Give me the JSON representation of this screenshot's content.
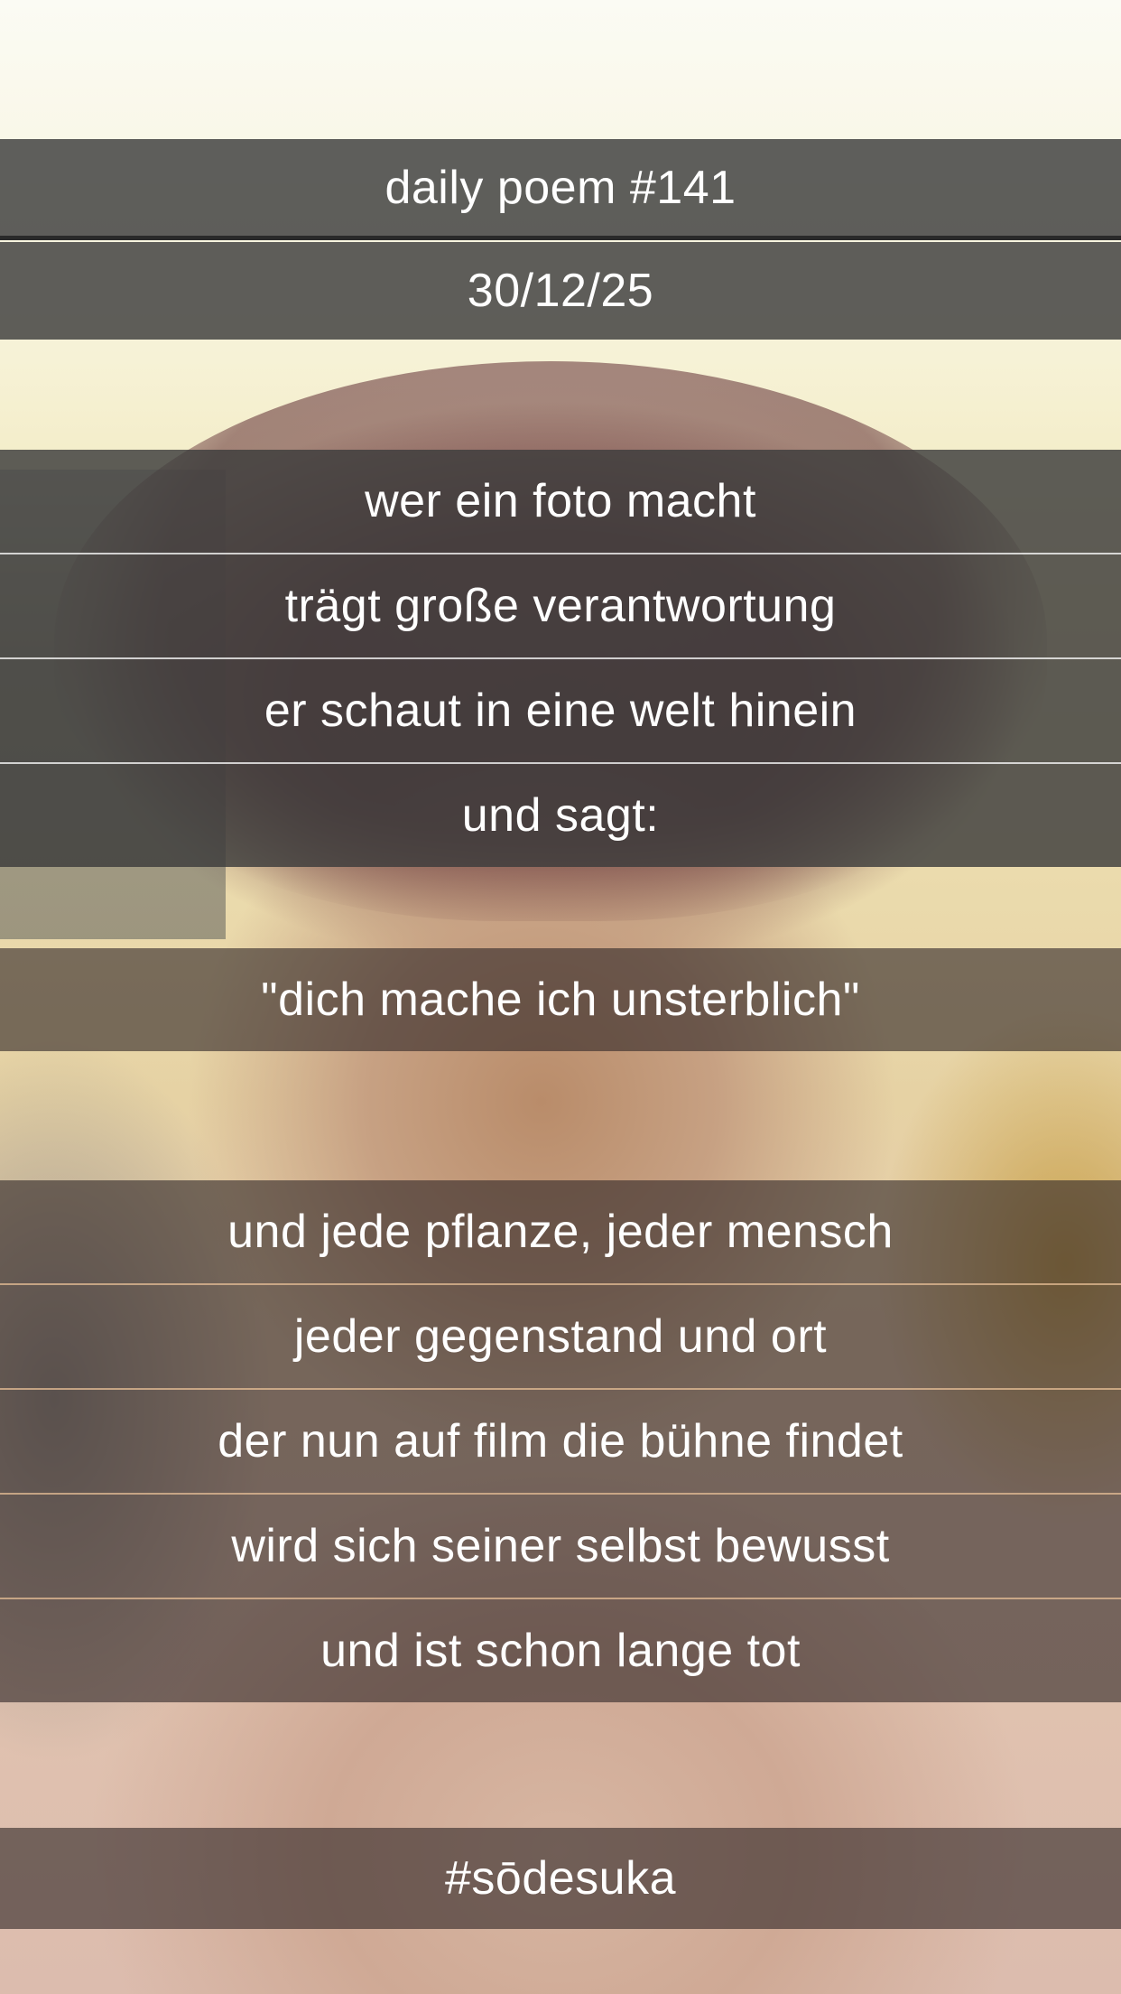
{
  "header": {
    "title": "daily poem #141",
    "date": "30/12/25"
  },
  "poem": {
    "stanza1": [
      "wer ein foto macht",
      "trägt große verantwortung",
      "er schaut in eine welt hinein",
      "und sagt:"
    ],
    "quote": "\"dich mache ich unsterblich\"",
    "stanza2": [
      "und jede pflanze, jeder mensch",
      "jeder gegenstand und ort",
      "der nun auf film die bühne findet",
      "wird sich seiner selbst bewusst",
      "und ist schon lange tot"
    ]
  },
  "footer": {
    "hashtag": "#sōdesuka"
  }
}
